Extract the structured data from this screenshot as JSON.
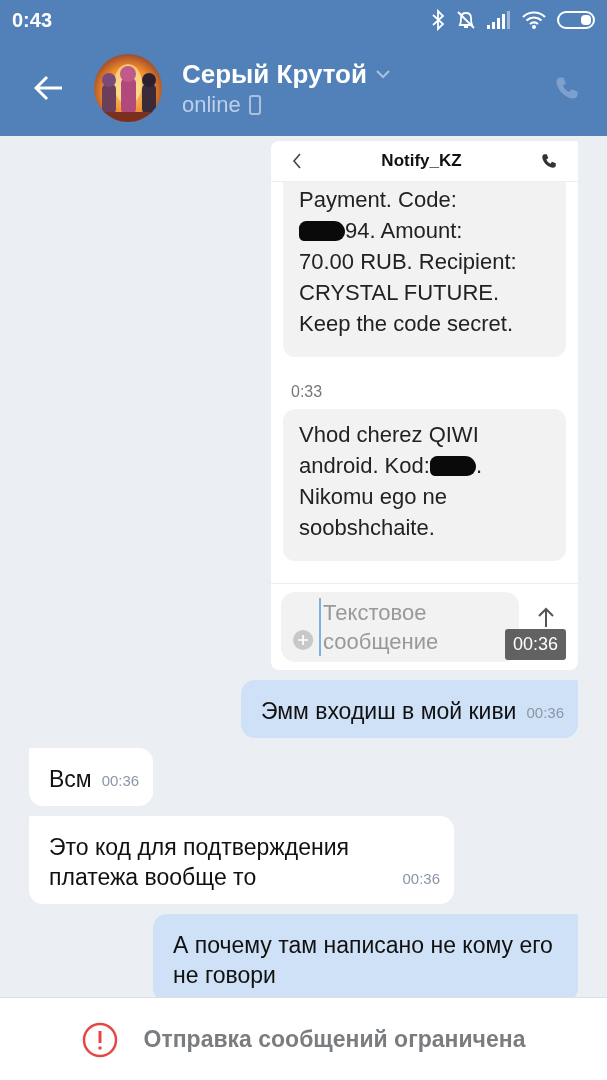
{
  "status_bar": {
    "time": "0:43"
  },
  "header": {
    "name": "Серый Крутой",
    "status": "online"
  },
  "messages": [
    {
      "outgoing": true,
      "time": "00:36",
      "screenshot": {
        "title": "Notify_KZ",
        "sms": [
          {
            "lines": [
              [
                {
                  "kind": "text",
                  "text": "Payment. Code:"
                }
              ],
              [
                {
                  "kind": "redacted"
                },
                {
                  "kind": "text",
                  "text": "94. Amount:"
                }
              ],
              [
                {
                  "kind": "text",
                  "text": "70.00 RUB. Recipient:"
                }
              ],
              [
                {
                  "kind": "text",
                  "text": "CRYSTAL FUTURE."
                }
              ],
              [
                {
                  "kind": "text",
                  "text": "Keep the code secret."
                }
              ]
            ]
          },
          {
            "time": "0:33",
            "lines": [
              [
                {
                  "kind": "text",
                  "text": "Vhod cherez QIWI"
                }
              ],
              [
                {
                  "kind": "text",
                  "text": "android. Kod:"
                },
                {
                  "kind": "redacted"
                },
                {
                  "kind": "text",
                  "text": "."
                }
              ],
              [
                {
                  "kind": "text",
                  "text": "Nikomu ego ne"
                }
              ],
              [
                {
                  "kind": "text",
                  "text": "soobshchaite."
                }
              ]
            ]
          }
        ],
        "placeholder": "Текстовое сообщение"
      }
    },
    {
      "kind": "text",
      "outgoing": true,
      "text": "Эмм входиш в мой киви",
      "time": "00:36"
    },
    {
      "kind": "text",
      "outgoing": false,
      "text": "Всм",
      "time": "00:36"
    },
    {
      "kind": "text",
      "outgoing": false,
      "text": "Это код для подтверждения платежа вообще то",
      "time": "00:36"
    },
    {
      "kind": "text",
      "outgoing": true,
      "text": "А почему там написано не кому его не говори"
    }
  ],
  "notice": "Отправка сообщений ограничена"
}
